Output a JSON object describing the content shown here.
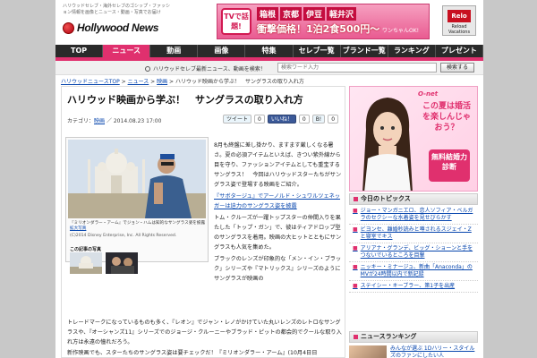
{
  "header": {
    "tagline": "ハリウッドセレブ・海外セレブのゴシップ・ファッション情報を画像とニュース・動画・写真でお届け",
    "logo_text": "Hollywood News"
  },
  "ad_banner": {
    "tv_label": "TVで話題!",
    "places": [
      "箱根",
      "京都",
      "伊豆",
      "軽井沢"
    ],
    "price_text": "衝撃価格！1泊2食500円〜",
    "sub_text": "ワンちゃんOK!",
    "logo_caption": "Relo",
    "logo_sub": "Reload Vacations"
  },
  "nav": {
    "items": [
      "TOP",
      "ニュース",
      "動画",
      "画像",
      "特集",
      "セレブ一覧",
      "ブランド一覧",
      "ランキング",
      "プレゼント"
    ],
    "active_index": 1
  },
  "search": {
    "label": "ハリウッドセレブ最新ニュース、動画を検索！",
    "placeholder": "検索ワード入力",
    "button": "検索する"
  },
  "breadcrumb": {
    "items": [
      "ハリウッドニュースTOP",
      "ニュース",
      "映画"
    ],
    "current": "ハリウッド映画から学ぶ！　サングラスの取り入れ方",
    "separator": " > "
  },
  "article": {
    "title": "ハリウッド映画から学ぶ！　サングラスの取り入れ方",
    "category_label": "カテゴリ：",
    "category": "映画",
    "date": "／ 2014.08.23 17:00",
    "share": {
      "tweet": "ツイート",
      "tweet_count": "0",
      "like": "いいね！",
      "like_count": "0",
      "bookmark": "B!",
      "bookmark_count": "0"
    },
    "photo_caption": "『ミリオンダラー・アーム』でジョン・ハムは知的なサングラス姿を披露",
    "photo_caption_link": "拡大写真",
    "photo_copyright": "(C)2014 Disney Enterprise, Inc. All Rights Reserved.",
    "related_title": "この記事の写真",
    "paragraph_1": "8月も終盤に差し掛かり、ますます厳しくなる暑さ。夏の必須アイテムといえば、きつい紫外線から目を守り、ファッションアイテムとしても重宝するサングラス！　今回はハリウッドスターたちがサングラス姿で登場する映画をご紹介。",
    "highlight_link": "『サボタージュ』でアーノルド・シュワルツェネッガーは迫力のサングラス姿を披露",
    "paragraph_2": "トム・クルーズが一躍トップスターの仲間入りを果たした「トップ・ガン」で、彼はティアドロップ型のサングラスを着用。映画の大ヒットとともにサングラスも人気を集めた。",
    "paragraph_3_part": "ブラックのレンズが印象的な「メン・イン・ブラック」シリーズや『マトリックス』シリーズのようにサングラスが映画の",
    "paragraph_3_rest": "トレードマークになっているものも多く、『レオン』でジャン・レノがかけていた丸いレンズのレトロなサングラスや、『オーシャンズ11』シリーズでのジョージ・クルーニーやブラッド・ピットの都会的でクールな取り入れ方は永遠の憧れだろう。",
    "paragraph_4": "新作映画でも、スターたちのサングラス姿は要チェックだ！『ミリオンダラー・アーム』(10月4日日"
  },
  "sidebar": {
    "ad": {
      "brand": "O-net",
      "copy": "この夏は婚活を楽しんじゃおう？",
      "badge": "無料結婚力診断"
    },
    "topics_title": "今日のトピックス",
    "topics": [
      "ジョー・マンガニエロ、恋人ソフィア・ベルガラのセクシーな水着姿を見せびらかす",
      "ビヨンセ、離婚秒読みと噂されるスジェイ・Zと寝室でキス",
      "アリアナ・グランデ、ビッグ・ショーンと手をつないでいるところを目撃",
      "ニッキー・ミナージュ、新曲「Anaconda」のMVが24時間以内で新記録",
      "ステイシー・キーブラー、第1子を出産"
    ],
    "ranking_title": "ニュースランキング",
    "ranking_first": "みんなが選ぶ 1Dハリー・スタイルズのファンにしたい人"
  },
  "colors": {
    "accent": "#e0306e",
    "nav_bg": "#2a2a2a",
    "link": "#0645ad"
  }
}
